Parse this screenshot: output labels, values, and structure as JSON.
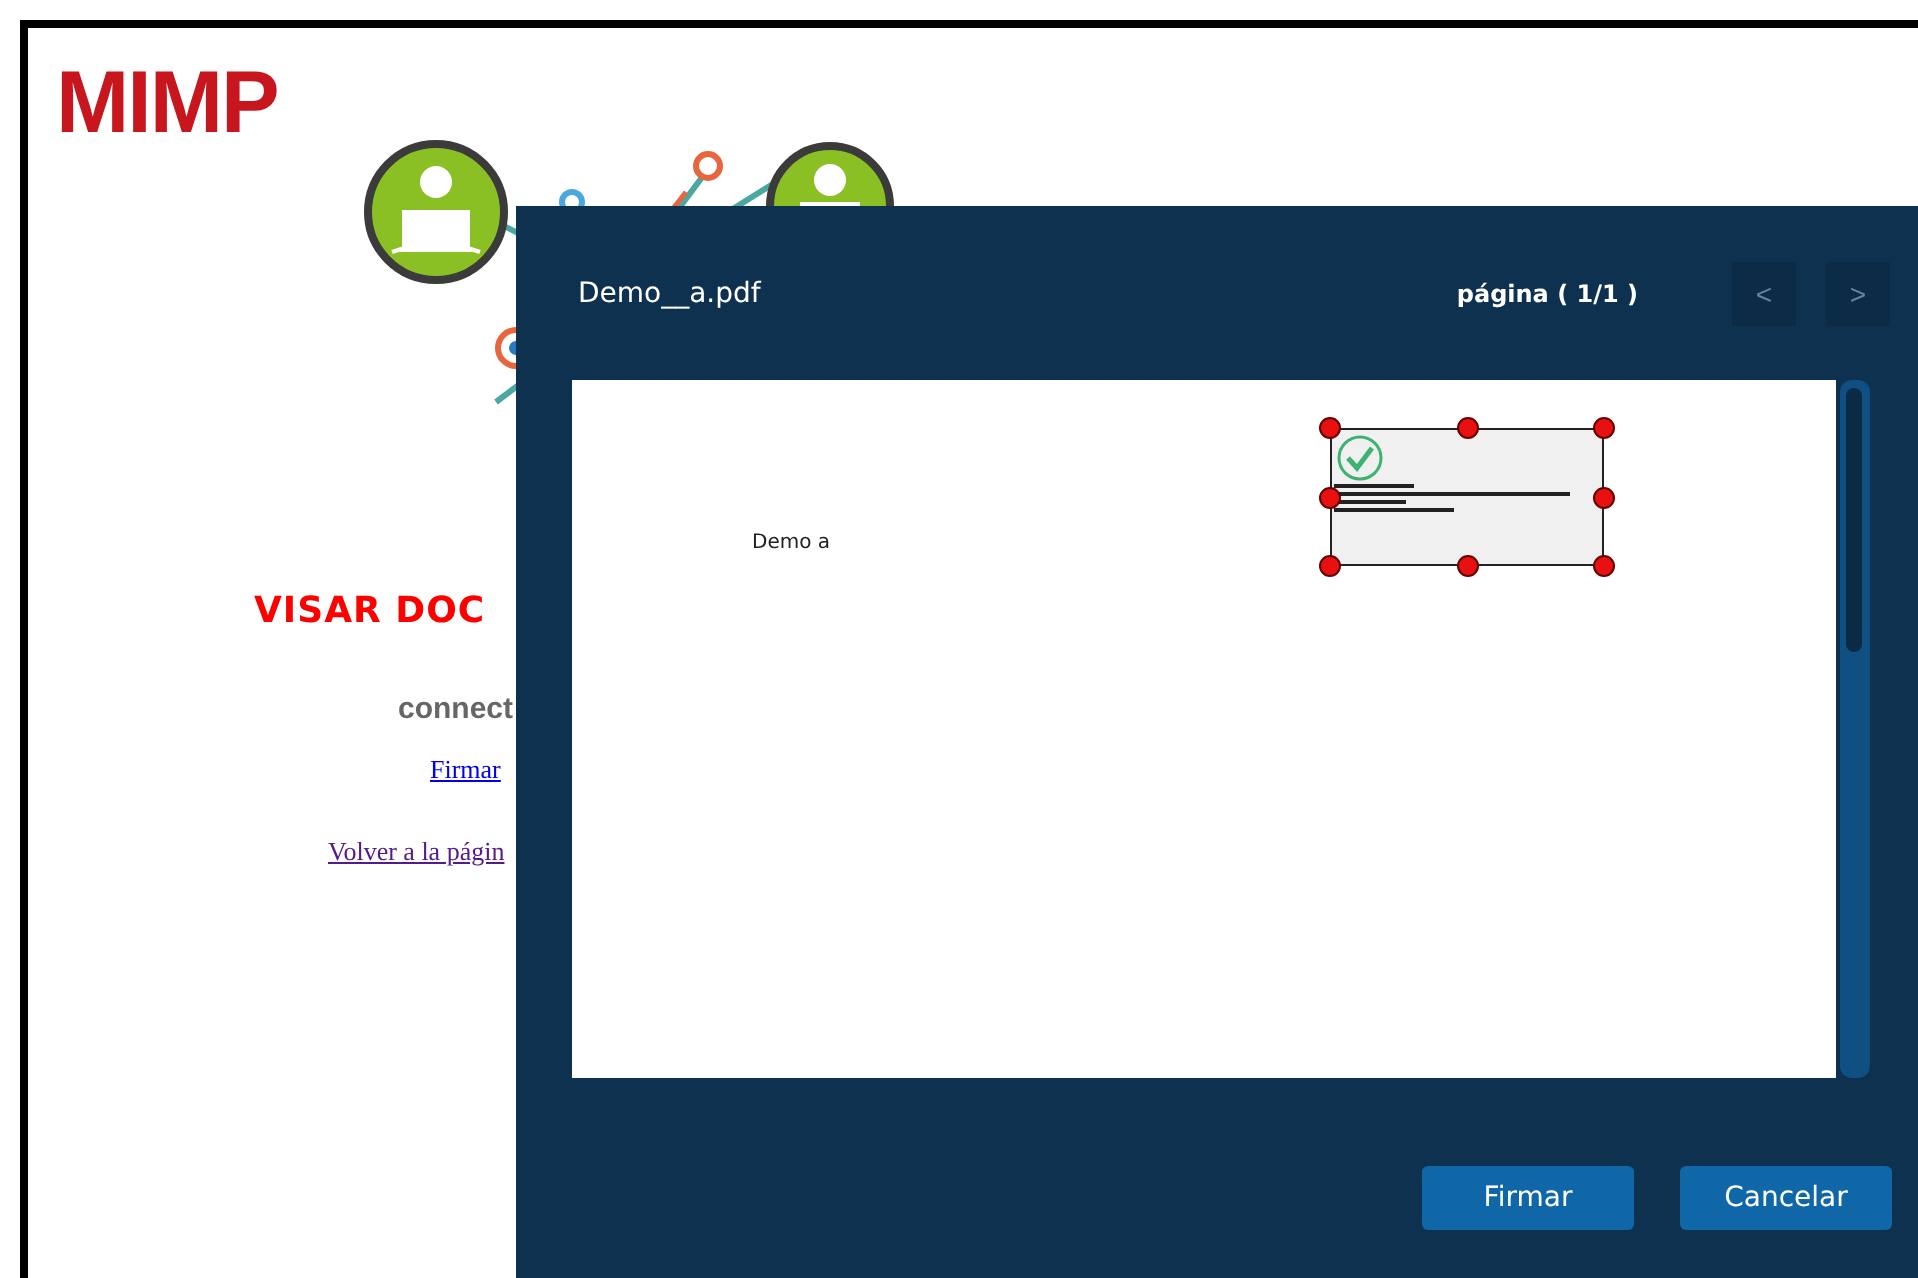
{
  "logo": "MIMP",
  "heading": "VISAR DOC",
  "status": "connect",
  "links": [
    {
      "label": "Firmar",
      "visited": false
    },
    {
      "label": "Volver a la págin",
      "visited": true
    }
  ],
  "viewer": {
    "title": "Demo__a.pdf",
    "page_label": "página ( 1/1 )",
    "prev": "<",
    "next": ">",
    "document_text": "Demo a",
    "buttons": [
      {
        "label": "Firmar"
      },
      {
        "label": "Cancelar"
      }
    ]
  }
}
